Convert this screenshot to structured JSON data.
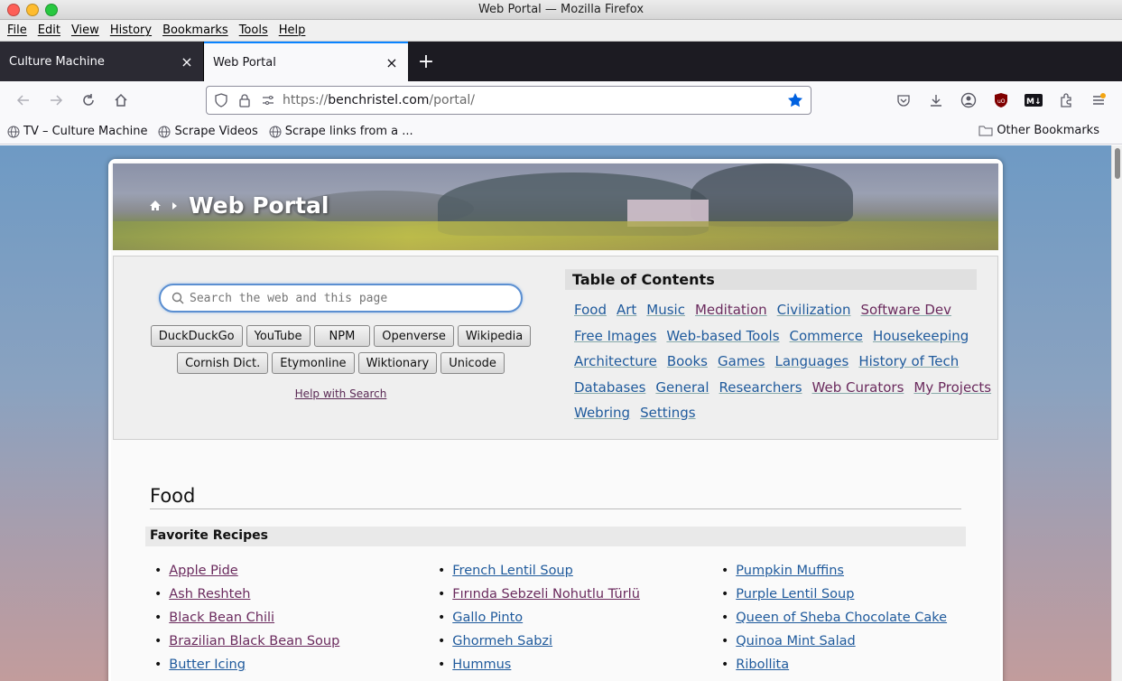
{
  "window": {
    "title": "Web Portal — Mozilla Firefox"
  },
  "menu": [
    "File",
    "Edit",
    "View",
    "History",
    "Bookmarks",
    "Tools",
    "Help"
  ],
  "tabs": [
    {
      "label": "Culture Machine",
      "active": false
    },
    {
      "label": "Web Portal",
      "active": true
    }
  ],
  "url": {
    "prefix": "https://",
    "domain": "benchristel.com",
    "path": "/portal/"
  },
  "bookmarks": {
    "items": [
      "TV – Culture Machine",
      "Scrape Videos",
      "Scrape links from a ..."
    ],
    "other": "Other Bookmarks"
  },
  "page": {
    "title": "Web Portal",
    "search_placeholder": "Search the web and this page",
    "search_buttons_row1": [
      "DuckDuckGo",
      "YouTube",
      "NPM",
      "Openverse",
      "Wikipedia"
    ],
    "search_buttons_row2": [
      "Cornish Dict.",
      "Etymonline",
      "Wiktionary",
      "Unicode"
    ],
    "help_link": "Help with Search",
    "toc_title": "Table of Contents",
    "toc_links": [
      [
        "Food",
        "Art",
        "Music",
        "Meditation",
        "Civilization",
        "Software Dev"
      ],
      [
        "Free Images",
        "Web-based Tools",
        "Commerce",
        "Housekeeping"
      ],
      [
        "Architecture",
        "Books",
        "Games",
        "Languages",
        "History of Tech"
      ],
      [
        "Databases",
        "General",
        "Researchers",
        "Web Curators",
        "My Projects"
      ],
      [
        "Webring",
        "Settings"
      ]
    ],
    "section_title": "Food",
    "subheading": "Favorite Recipes",
    "recipes_col1": [
      "Apple Pide",
      "Ash Reshteh",
      "Black Bean Chili",
      "Brazilian Black Bean Soup",
      "Butter Icing"
    ],
    "recipes_col2": [
      "French Lentil Soup",
      "Fırında Sebzeli Nohutlu Türlü",
      "Gallo Pinto",
      "Ghormeh Sabzi",
      "Hummus"
    ],
    "recipes_col3": [
      "Pumpkin Muffins",
      "Purple Lentil Soup",
      "Queen of Sheba Chocolate Cake",
      "Quinoa Mint Salad",
      "Ribollita"
    ]
  },
  "colors": {
    "link": "#1f5a9c",
    "visited": "#6a2a5d",
    "accent": "#0a84ff",
    "bookmark_star": "#0061e0"
  }
}
